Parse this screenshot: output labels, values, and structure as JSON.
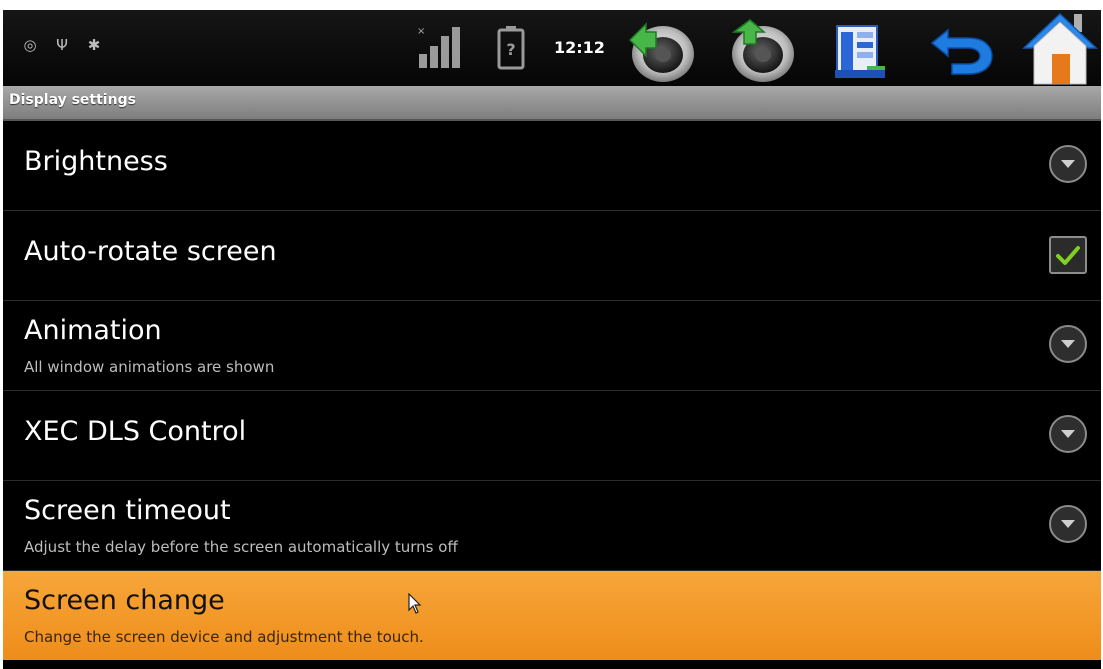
{
  "status_bar": {
    "left_icons": [
      "target-icon",
      "usb-icon",
      "debug-bug-icon"
    ],
    "clock": "12:12",
    "icons": [
      "signal-icon",
      "battery-icon",
      "volume-down-icon",
      "volume-up-icon",
      "menu-icon",
      "back-icon",
      "home-icon"
    ]
  },
  "title": "Display settings",
  "settings": [
    {
      "label": "Brightness",
      "summary": "",
      "control": "chevron-down-icon"
    },
    {
      "label": "Auto-rotate screen",
      "summary": "",
      "control": "checkbox",
      "checked": true
    },
    {
      "label": "Animation",
      "summary": "All window animations are shown",
      "control": "chevron-down-icon"
    },
    {
      "label": "XEC DLS Control",
      "summary": "",
      "control": "chevron-down-icon"
    },
    {
      "label": "Screen timeout",
      "summary": "Adjust the delay before the screen automatically turns off",
      "control": "chevron-down-icon"
    },
    {
      "label": "Screen change",
      "summary": "Change the screen device and adjustment the touch.",
      "selected": true
    }
  ],
  "colors": {
    "highlight": "#F09A2A",
    "check": "#7FD020",
    "accent_blue": "#1E7BE0"
  }
}
